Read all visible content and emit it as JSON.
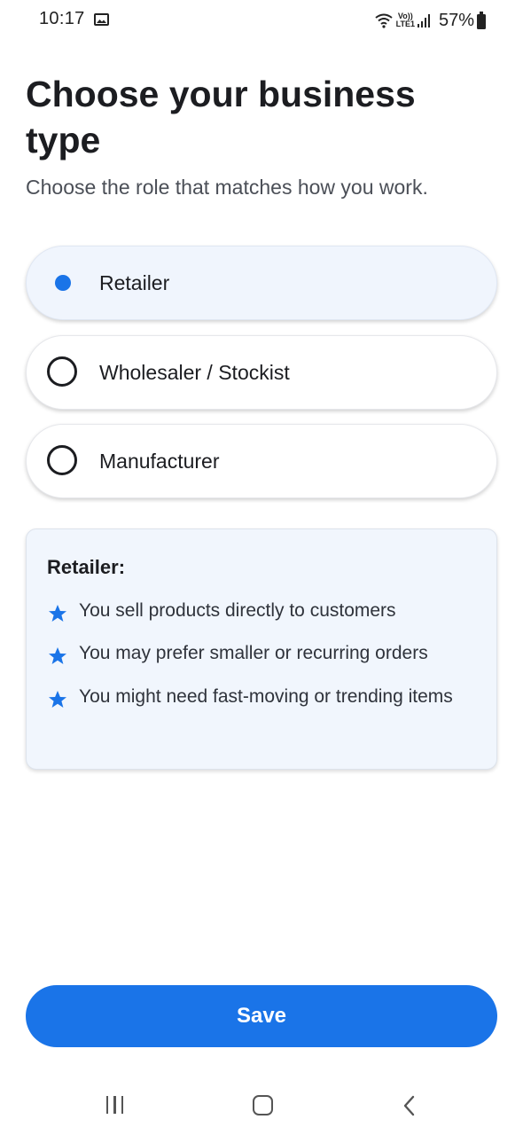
{
  "status_bar": {
    "time": "10:17",
    "volte_top": "Vo))",
    "volte_bottom": "LTE1",
    "battery": "57%",
    "icons": [
      "gallery-icon",
      "wifi-icon",
      "volte-icon",
      "signal-icon",
      "battery-icon"
    ]
  },
  "header": {
    "title": "Choose your business type",
    "subtitle": "Choose the role that matches how you work."
  },
  "options": [
    {
      "label": "Retailer",
      "selected": true
    },
    {
      "label": "Wholesaler / Stockist",
      "selected": false
    },
    {
      "label": "Manufacturer",
      "selected": false
    }
  ],
  "info": {
    "title": "Retailer:",
    "points": [
      "You sell products directly to customers",
      "You may prefer smaller or recurring orders",
      "You might need fast-moving or trending items"
    ],
    "bullet_icon": "star-icon"
  },
  "save_label": "Save",
  "nav": {
    "icons": [
      "recents-icon",
      "home-icon",
      "back-icon"
    ]
  },
  "colors": {
    "accent": "#1a74e8",
    "selected_bg": "#f0f5fd",
    "info_bg": "#f1f6fd",
    "text": "#1c1d21"
  }
}
